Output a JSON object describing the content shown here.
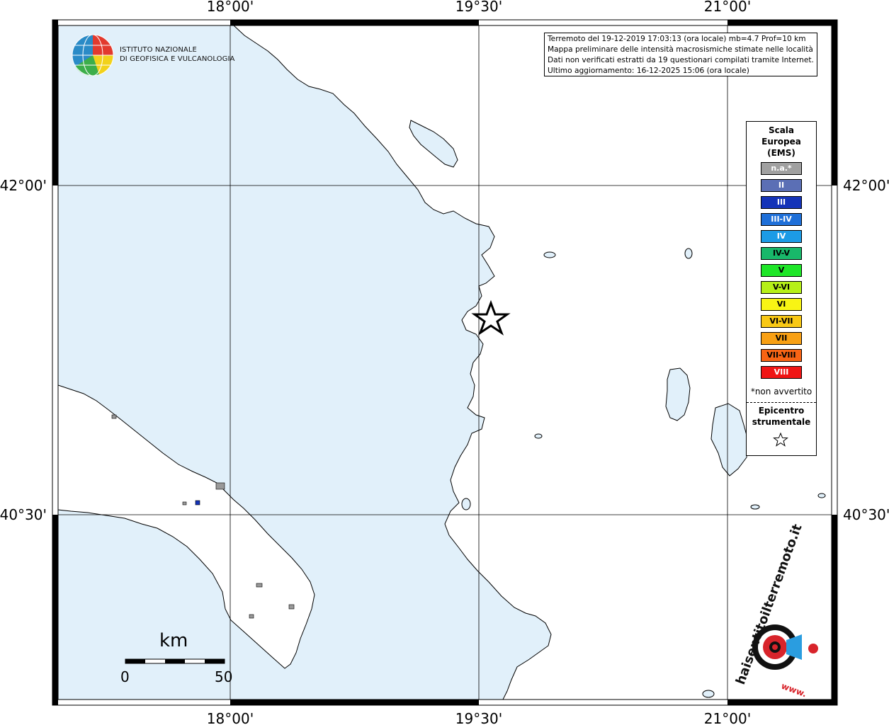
{
  "map": {
    "lon_ticks": [
      "18°00'",
      "19°30'",
      "21°00'"
    ],
    "lat_ticks": [
      "42°00'",
      "40°30'"
    ]
  },
  "logo": {
    "line1": "ISTITUTO NAZIONALE",
    "line2": "DI GEOFISICA E VULCANOLOGIA"
  },
  "info": {
    "line1": "Terremoto del 19-12-2019 17:03:13 (ora locale) mb=4.7 Prof=10 km",
    "line2": "Mappa preliminare delle intensità macrosismiche stimate nelle località",
    "line3": "Dati non verificati estratti da 19 questionari compilati tramite Internet.",
    "line4": "Ultimo aggiornamento: 16-12-2025 15:06 (ora locale)"
  },
  "legend": {
    "title_lines": [
      "Scala",
      "Europea",
      "(EMS)"
    ],
    "items": [
      {
        "label": "n.a.*",
        "color": "#a0a0a0",
        "text_color": "#ffffff"
      },
      {
        "label": "II",
        "color": "#5b6fb5",
        "text_color": "#ffffff"
      },
      {
        "label": "III",
        "color": "#1433b8",
        "text_color": "#ffffff"
      },
      {
        "label": "III-IV",
        "color": "#1e6fd8",
        "text_color": "#ffffff"
      },
      {
        "label": "IV",
        "color": "#1c9be6",
        "text_color": "#ffffff"
      },
      {
        "label": "IV-V",
        "color": "#18b86a",
        "text_color": "#000000"
      },
      {
        "label": "V",
        "color": "#1ee628",
        "text_color": "#000000"
      },
      {
        "label": "V-VI",
        "color": "#b6f018",
        "text_color": "#000000"
      },
      {
        "label": "VI",
        "color": "#f8f414",
        "text_color": "#000000"
      },
      {
        "label": "VI-VII",
        "color": "#f8c814",
        "text_color": "#000000"
      },
      {
        "label": "VII",
        "color": "#f8a014",
        "text_color": "#000000"
      },
      {
        "label": "VII-VIII",
        "color": "#f86414",
        "text_color": "#000000"
      },
      {
        "label": "VIII",
        "color": "#f01414",
        "text_color": "#ffffff"
      }
    ],
    "note": "*non avvertito",
    "epicenter_lines": [
      "Epicentro",
      "strumentale"
    ]
  },
  "scale": {
    "unit": "km",
    "min_label": "0",
    "max_label": "50"
  },
  "hsit_logo": {
    "brand": "haisentitoilterremoto.it",
    "www": "www."
  },
  "colors": {
    "sea": "#e1f0fa",
    "land": "#ffffff",
    "coast": "#000000"
  }
}
